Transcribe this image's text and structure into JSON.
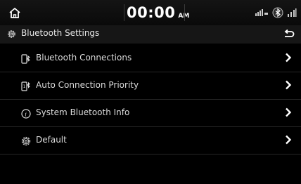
{
  "status_bar": {
    "time": "00:00",
    "ampm": "AM"
  },
  "header": {
    "title": "Bluetooth Settings"
  },
  "menu": {
    "items": [
      {
        "label": "Bluetooth Connections",
        "icon": "bluetooth-phone-icon"
      },
      {
        "label": "Auto Connection Priority",
        "icon": "bluetooth-priority-icon"
      },
      {
        "label": "System Bluetooth Info",
        "icon": "info-icon"
      },
      {
        "label": "Default",
        "icon": "gear-icon"
      }
    ]
  },
  "colors": {
    "background": "#000000",
    "header_bg": "#161616",
    "text": "#e8e8e8",
    "divider": "#262626"
  }
}
